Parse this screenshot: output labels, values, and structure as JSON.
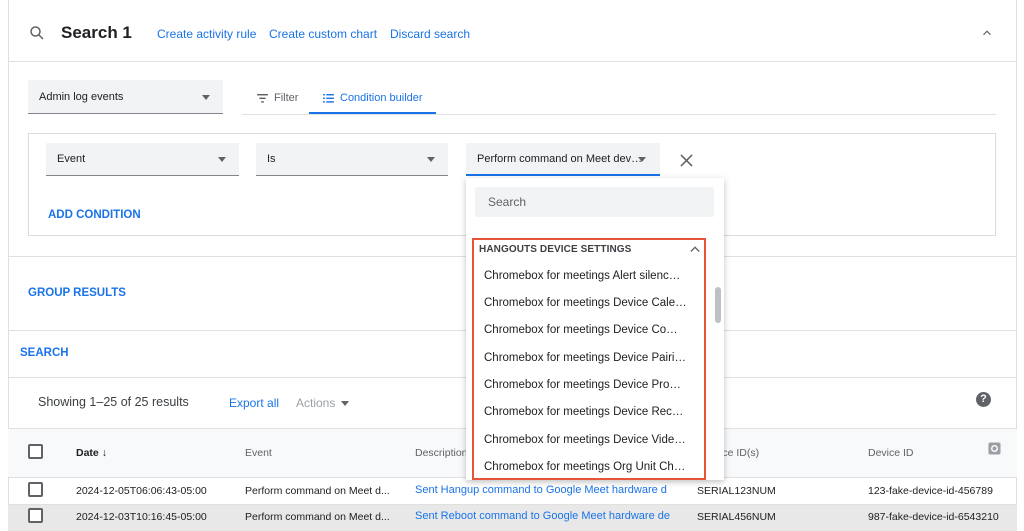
{
  "header": {
    "title": "Search 1",
    "links": [
      "Create activity rule",
      "Create custom chart",
      "Discard search"
    ]
  },
  "source_select": {
    "value": "Admin log events"
  },
  "tabs": {
    "filter": "Filter",
    "condition_builder": "Condition builder"
  },
  "condition": {
    "field": "Event",
    "operator": "Is",
    "value": "Perform command on Meet dev…"
  },
  "buttons": {
    "add_condition": "ADD CONDITION",
    "group_results": "GROUP RESULTS",
    "search": "SEARCH"
  },
  "dropdown": {
    "search_placeholder": "Search",
    "group_label": "HANGOUTS DEVICE SETTINGS",
    "options": [
      "Chromebox for meetings Alert silenc…",
      "Chromebox for meetings Device Cale…",
      "Chromebox for meetings Device Co…",
      "Chromebox for meetings Device Pairi…",
      "Chromebox for meetings Device Pro…",
      "Chromebox for meetings Device Rec…",
      "Chromebox for meetings Device Vide…",
      "Chromebox for meetings Org Unit Ch…"
    ]
  },
  "results": {
    "showing": "Showing 1–25 of 25 results",
    "export": "Export all",
    "actions": "Actions"
  },
  "table": {
    "headers": {
      "date": "Date",
      "event": "Event",
      "description": "Description",
      "source": "urce ID(s)",
      "device": "Device ID"
    },
    "rows": [
      {
        "date": "2024-12-05T06:06:43-05:00",
        "event": "Perform command on Meet d...",
        "description": "Sent Hangup command to Google Meet hardware d",
        "source": "SERIAL123NUM",
        "device": "123-fake-device-id-456789"
      },
      {
        "date": "2024-12-03T10:16:45-05:00",
        "event": "Perform command on Meet d...",
        "description": "Sent Reboot command to Google Meet hardware de",
        "source": "SERIAL456NUM",
        "device": "987-fake-device-id-6543210"
      }
    ]
  },
  "colors": {
    "accent": "#1a73e8",
    "highlight": "#e8543a"
  }
}
